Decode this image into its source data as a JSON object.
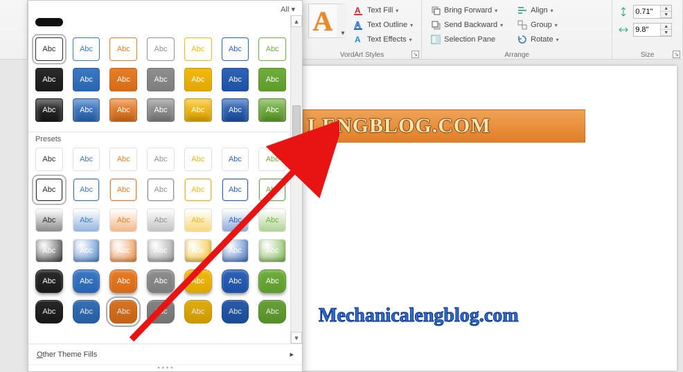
{
  "ribbon": {
    "wordart_glyph": "A",
    "wordart_styles_label": "VordArt Styles",
    "text_fill_label": "Text Fill",
    "text_outline_label": "Text Outline",
    "text_effects_label": "Text Effects",
    "arrange_label": "Arrange",
    "bring_forward_label": "Bring Forward",
    "send_backward_label": "Send Backward",
    "selection_pane_label": "Selection Pane",
    "align_label": "Align",
    "group_label": "Group",
    "rotate_label": "Rotate",
    "size_label": "Size",
    "height_value": "0.71\"",
    "width_value": "9.8\""
  },
  "gallery": {
    "filter_label": "All",
    "presets_label": "Presets",
    "other_fills_label": "Other Theme Fills",
    "swatch_text": "Abc",
    "palette": {
      "black": "#2b2b2b",
      "blue": "#3b78c4",
      "orange": "#e87d28",
      "gray": "#8f8f8f",
      "gold": "#f2b90f",
      "blue2": "#2e63b7",
      "green": "#6fae3c"
    }
  },
  "document": {
    "wordart_text": "LENGBLOG.COM",
    "caption_text": "Mechanicalengblog.com"
  }
}
